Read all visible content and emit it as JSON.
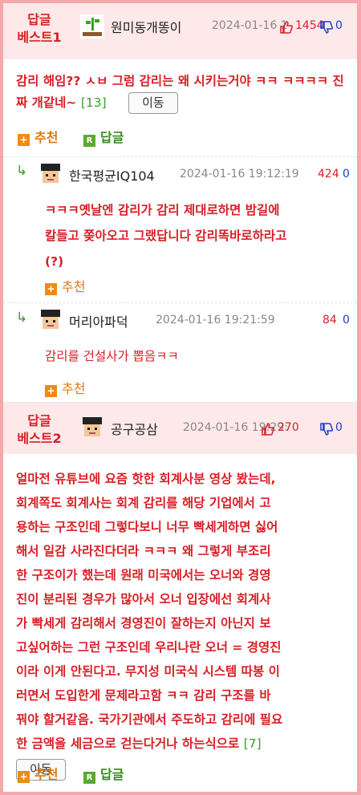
{
  "best1": {
    "label_line1": "답글",
    "label_line2": "베스트1",
    "nick": "원미동개똥이",
    "date": "2024-01-16 1",
    "up": "1454",
    "down": "0",
    "body": "감리 해임?? ㅅㅂ 그럼 감리는 왜 시키는거야 ㅋㅋ ㅋㅋㅋㅋ 진짜 개같네~",
    "count": "[13]",
    "move_label": "이동",
    "recommend_label": "추천",
    "reply_label": "답글"
  },
  "reply1": {
    "nick": "한국평균IQ104",
    "date": "2024-01-16 19:12:19",
    "up": "424",
    "down": "0",
    "body_line1": "ㅋㅋㅋ옛날엔 감리가 감리 제대로하면 밤길에",
    "body_line2": "칼들고 쫒아오고 그랬답니다 감리똑바로하라고",
    "body_line3": "(?)",
    "recommend_label": "추천"
  },
  "reply2": {
    "nick": "머리아파덕",
    "date": "2024-01-16 19:21:59",
    "up": "84",
    "down": "0",
    "body": "감리를 건설사가 뽑음ㅋㅋ",
    "recommend_label": "추천"
  },
  "best2": {
    "label_line1": "답글",
    "label_line2": "베스트2",
    "nick": "공구공삼",
    "date": "2024-01-16 19:29:",
    "up": "270",
    "down": "0",
    "lines": [
      "얼마전 유튜브에 요즘 핫한 회계사분 영상 봤는데,",
      "회계쪽도 회계사는 회계 감리를 해당 기업에서 고",
      "용하는 구조인데 그렇다보니 너무 빡세게하면 싫어",
      "해서 일감 사라진다더라 ㅋㅋㅋ 왜 그렇게 부조리",
      "한 구조이가 했는데 원래 미국에서는 오너와 경영",
      "진이 분리된 경우가 많아서 오너 입장에선 회계사",
      "가 빡세게 감리해서 경영진이 잘하는지 아닌지 보",
      "고싶어하는 그런 구조인데 우리나란 오너 = 경영진",
      "이라 이게 안된다고. 무지성 미국식 시스템 따봉 이",
      "러면서 도입한게 문제라고함 ㅋㅋ 감리 구조를 바",
      "꿔야 할거같음. 국가기관에서 주도하고 감리에 필요",
      "한 금액을 세금으로 걷는다거나 하는식으로"
    ],
    "count": "[7]",
    "move_label": "이동",
    "recommend_label": "추천",
    "reply_label": "답글"
  },
  "colors": {
    "frame": "#f6a7ab",
    "best_bg": "#fde8ea",
    "red_text": "#d81f26",
    "blue": "#1a3fc9",
    "green": "#3aa02a",
    "orange": "#f08b11"
  },
  "icons": [
    "sprout-avatar-icon",
    "pixel-face-avatar-icon",
    "thumb-up-icon",
    "thumb-down-icon",
    "plus-icon",
    "reply-r-icon",
    "reply-arrow-icon"
  ]
}
